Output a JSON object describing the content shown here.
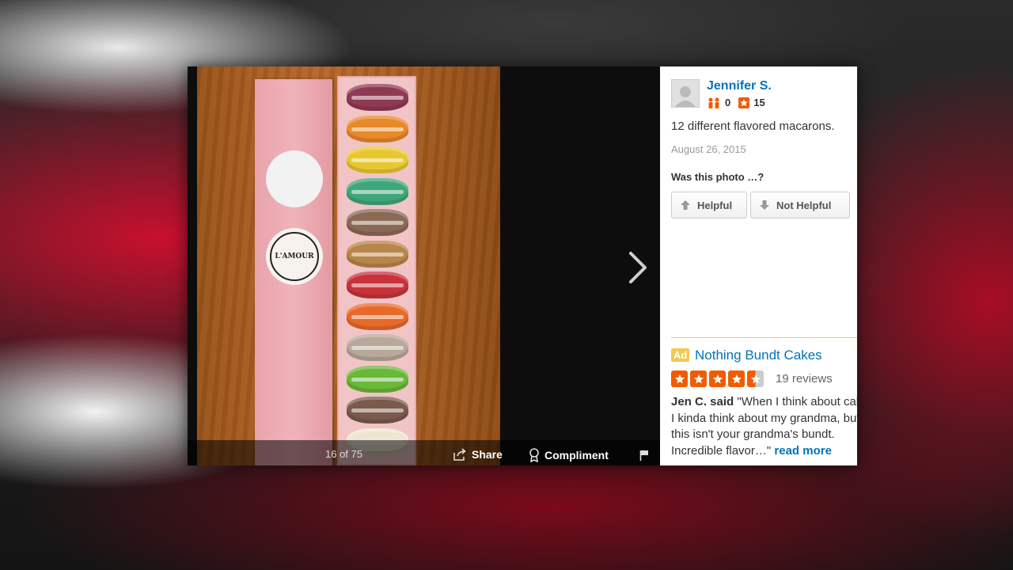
{
  "viewer": {
    "counter": "16 of 75",
    "share_label": "Share",
    "compliment_label": "Compliment"
  },
  "user": {
    "name": "Jennifer S.",
    "friends_count": "0",
    "reviews_count": "15"
  },
  "photo_info": {
    "caption": "12 different flavored macarons.",
    "date": "August 26, 2015",
    "question": "Was this photo …?",
    "helpful_label": "Helpful",
    "not_helpful_label": "Not Helpful"
  },
  "ad": {
    "badge": "Ad",
    "business_name": "Nothing Bundt Cakes",
    "rating": 4.5,
    "reviews": "19 reviews",
    "reviewer": "Jen C. said",
    "quote": "\"When I think about cakes I kinda think about my grandma, but this isn't your grandma's bundt. Incredible flavor…\"",
    "read_more": "read more"
  },
  "colors": {
    "link": "#0073bb",
    "star": "#f15c00",
    "ad_badge": "#f2c94c"
  },
  "macaron_colors": [
    "#8e3a55",
    "#e8892b",
    "#e8c832",
    "#3fa87a",
    "#8a6a55",
    "#b8864a",
    "#c8333b",
    "#e86a2a",
    "#b8a89a",
    "#6ab83a",
    "#7a5a4a",
    "#efe6d2"
  ]
}
